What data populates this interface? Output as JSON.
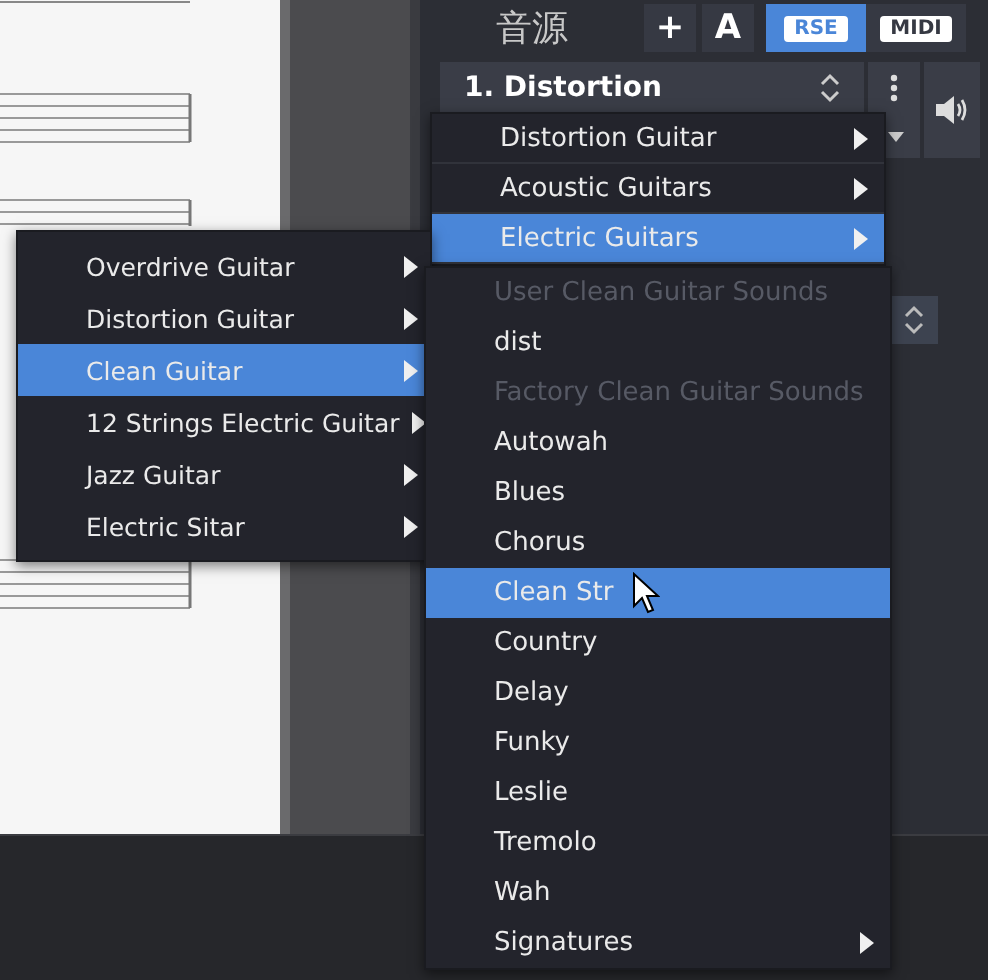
{
  "panel": {
    "title": "音源",
    "tools": [
      {
        "label": "+"
      },
      {
        "label": "A"
      }
    ],
    "modes": [
      {
        "label": "RSE",
        "selected": true
      },
      {
        "label": "MIDI",
        "selected": false
      }
    ],
    "track": {
      "label": "1. Distortion"
    }
  },
  "menus": [
    {
      "items": [
        {
          "kind": "item",
          "label": "Distortion Guitar",
          "submenu": true,
          "selected": false
        },
        {
          "kind": "item",
          "label": "Acoustic Guitars",
          "submenu": true,
          "selected": false
        },
        {
          "kind": "item",
          "label": "Electric Guitars",
          "submenu": true,
          "selected": true
        }
      ]
    },
    {
      "items": [
        {
          "kind": "item",
          "label": "Overdrive Guitar",
          "submenu": true,
          "selected": false
        },
        {
          "kind": "item",
          "label": "Distortion Guitar",
          "submenu": true,
          "selected": false
        },
        {
          "kind": "item",
          "label": "Clean Guitar",
          "submenu": true,
          "selected": true
        },
        {
          "kind": "item",
          "label": "12 Strings Electric Guitar",
          "submenu": true,
          "selected": false
        },
        {
          "kind": "item",
          "label": "Jazz Guitar",
          "submenu": true,
          "selected": false
        },
        {
          "kind": "item",
          "label": "Electric Sitar",
          "submenu": true,
          "selected": false
        }
      ]
    },
    {
      "items": [
        {
          "kind": "header",
          "label": "User Clean Guitar Sounds"
        },
        {
          "kind": "item",
          "label": "dist",
          "submenu": false,
          "selected": false
        },
        {
          "kind": "header",
          "label": "Factory Clean Guitar Sounds"
        },
        {
          "kind": "item",
          "label": "Autowah",
          "submenu": false,
          "selected": false
        },
        {
          "kind": "item",
          "label": "Blues",
          "submenu": false,
          "selected": false
        },
        {
          "kind": "item",
          "label": "Chorus",
          "submenu": false,
          "selected": false
        },
        {
          "kind": "item",
          "label": "Clean Str",
          "submenu": false,
          "selected": true
        },
        {
          "kind": "item",
          "label": "Country",
          "submenu": false,
          "selected": false
        },
        {
          "kind": "item",
          "label": "Delay",
          "submenu": false,
          "selected": false
        },
        {
          "kind": "item",
          "label": "Funky",
          "submenu": false,
          "selected": false
        },
        {
          "kind": "item",
          "label": "Leslie",
          "submenu": false,
          "selected": false
        },
        {
          "kind": "item",
          "label": "Tremolo",
          "submenu": false,
          "selected": false
        },
        {
          "kind": "item",
          "label": "Wah",
          "submenu": false,
          "selected": false
        },
        {
          "kind": "item",
          "label": "Signatures",
          "submenu": true,
          "selected": false
        }
      ]
    }
  ]
}
